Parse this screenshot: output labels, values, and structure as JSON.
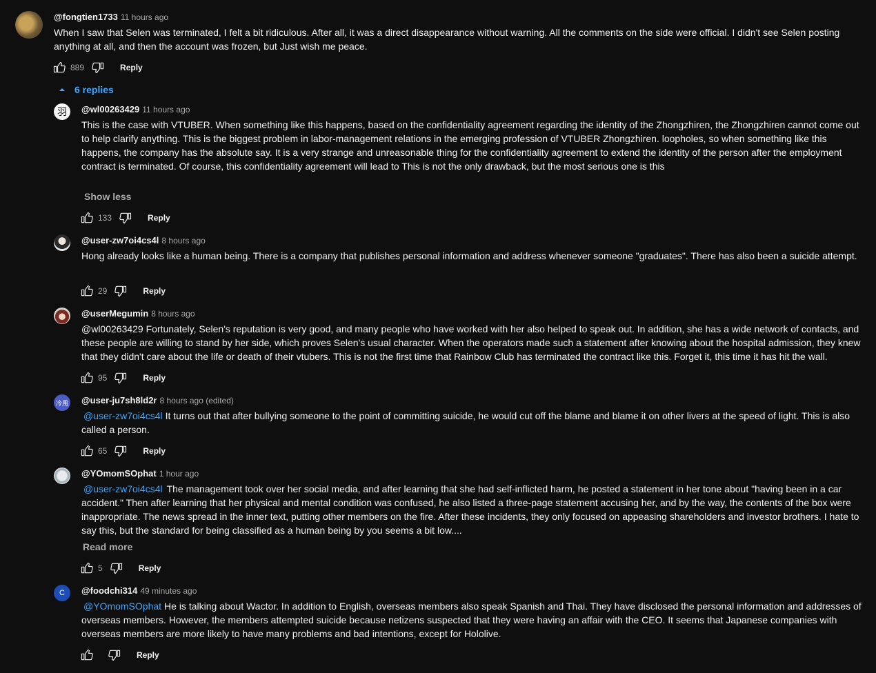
{
  "top_comment": {
    "handle": "@fongtien1733",
    "time": "11 hours ago",
    "text": "When I saw that Selen was terminated, I felt a bit ridiculous. After all, it was a direct disappearance without warning. All the comments on the side were official. I didn't see Selen posting anything at all, and then the account was frozen, but Just wish me peace.",
    "likes": "889",
    "reply_label": "Reply"
  },
  "replies_toggle": {
    "label": "6 replies",
    "icon": "chevron-up-icon"
  },
  "replies": [
    {
      "handle": "@wl00263429",
      "time": "11 hours ago",
      "avatar_text": "羽",
      "mention": "",
      "text": "This is the case with VTUBER. When something like this happens, based on the confidentiality agreement regarding the identity of the Zhongzhiren, the Zhongzhiren cannot come out to help clarify anything. This is the biggest problem in labor-management relations in the emerging profession of VTUBER Zhongzhiren. loopholes, so when something like this happens, the company has the absolute say. It is a very strange and unreasonable thing for the confidentiality agreement to extend the identity of the person after the employment contract is terminated. Of course, this confidentiality agreement will lead to This is not the only drawback, but the most serious one is this",
      "toggle": "Show less",
      "likes": "133",
      "reply_label": "Reply"
    },
    {
      "handle": "@user-zw7oi4cs4l",
      "time": "8 hours ago",
      "avatar_text": "",
      "mention": "",
      "text": "Hong already looks like a human being. There is a company that publishes personal information and address whenever someone \"graduates\". There has also been a suicide attempt.",
      "likes": "29",
      "reply_label": "Reply"
    },
    {
      "handle": "@userMegumin",
      "time": "8 hours ago",
      "avatar_text": "",
      "mention": "",
      "text": "@wl00263429 Fortunately, Selen's reputation is very good, and many people who have worked with her also helped to speak out. In addition, she has a wide network of contacts, and these people are willing to stand by her side, which proves Selen's usual character. When the operators made such a statement after knowing about the hospital admission, they knew that they didn't care about the life or death of their vtubers. This is not the first time that Rainbow Club has terminated the contract like this. Forget it, this time it has hit the wall.",
      "likes": "95",
      "reply_label": "Reply"
    },
    {
      "handle": "@user-ju7sh8ld2r",
      "time": "8 hours ago (edited)",
      "avatar_text": "冷風",
      "mention": "@user-zw7oi4cs4l",
      "text": "It turns out that after bullying someone to the point of committing suicide, he would cut off the blame and blame it on other livers at the speed of light. This is also called a person.",
      "likes": "65",
      "reply_label": "Reply"
    },
    {
      "handle": "@YOmomSOphat",
      "time": "1 hour ago",
      "avatar_text": "",
      "mention": "@user-zw7oi4cs4l",
      "text": "The management took over her social media, and after learning that she had self-inflicted harm, he posted a statement in her tone about \"having been in a car accident.\" Then after learning that her physical and mental condition was confused, he also listed a three-page statement accusing her, and by the way, the contents of the box were inappropriate. The news spread in the inner text, putting other members on the fire. After these incidents, they only focused on appeasing shareholders and investor brothers. I hate to say this, but the standard for being classified as a human being by you seems a bit low....",
      "toggle": "Read more",
      "likes": "5",
      "reply_label": "Reply"
    },
    {
      "handle": "@foodchi314",
      "time": "49 minutes ago",
      "avatar_text": "C",
      "mention": "@YOmomSOphat",
      "text": "He is talking about Wactor. In addition to English, overseas members also speak Spanish and Thai. They have disclosed the personal information and addresses of overseas members. However, the members attempted suicide because netizens suspected that they were having an affair with the CEO. It seems that Japanese companies with overseas members are more likely to have many problems and bad intentions, except for Hololive.",
      "likes": "",
      "reply_label": "Reply"
    }
  ],
  "colors": {
    "background": "#0f0f0f",
    "text": "#f1f1f1",
    "secondary_text": "#aaaaaa",
    "link": "#3ea6ff",
    "avatar_c": "#1e4db7",
    "avatar_cold_wind": "#4b5cc4"
  }
}
